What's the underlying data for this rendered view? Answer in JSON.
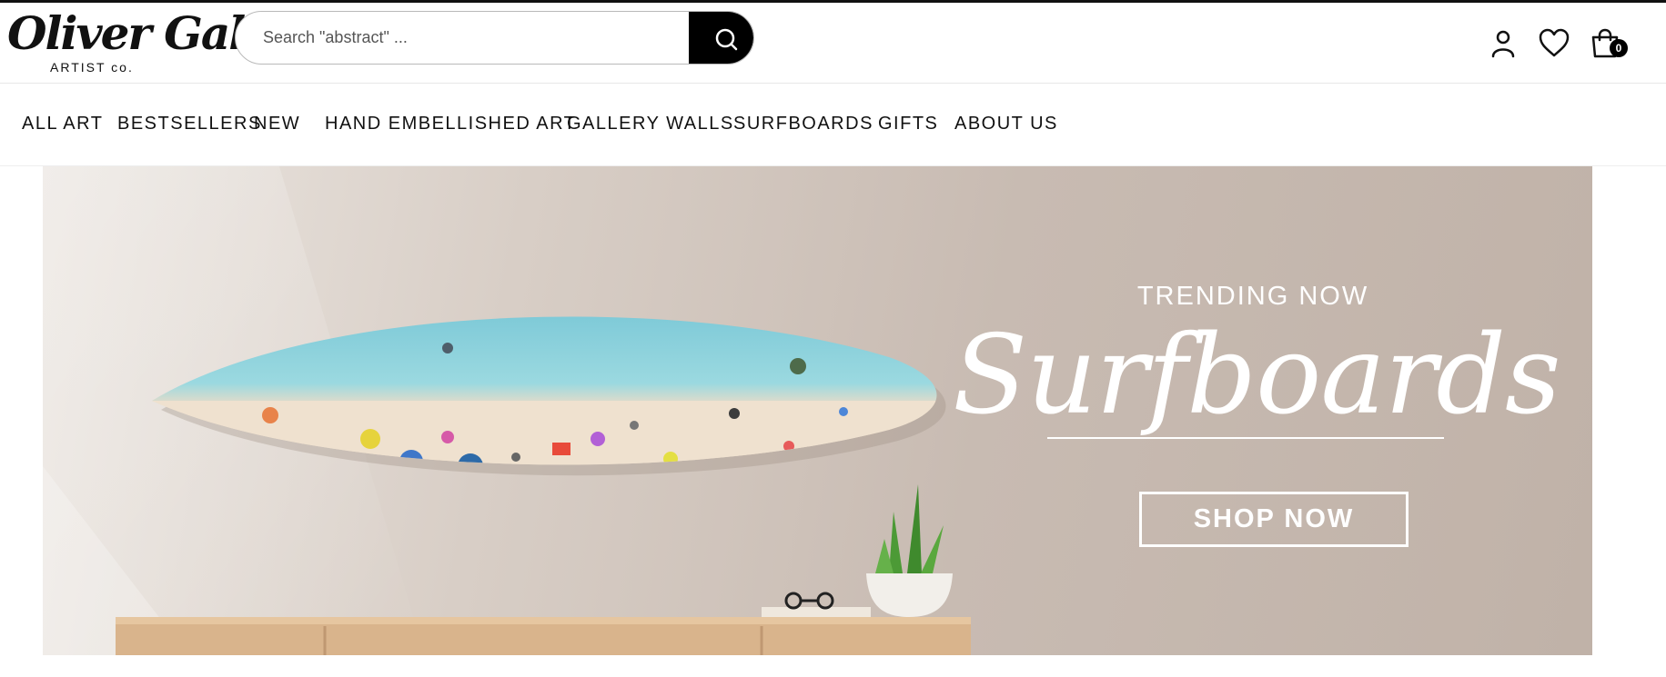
{
  "header": {
    "logo_script": "Oliver Gal",
    "logo_sub": "ARTIST co.",
    "search_placeholder": "Search \"abstract\" ...",
    "cart_count": "0"
  },
  "nav": {
    "items": [
      "ALL ART",
      "BESTSELLERS",
      "NEW",
      "HAND EMBELLISHED ART",
      "GALLERY WALLS",
      "SURFBOARDS",
      "GIFTS",
      "ABOUT US"
    ]
  },
  "hero": {
    "eyebrow": "TRENDING NOW",
    "headline": "Surfboards",
    "cta": "SHOP NOW"
  },
  "icons": {
    "search": "search-icon",
    "account": "user-icon",
    "wishlist": "heart-icon",
    "cart": "shopping-bag-icon"
  },
  "colors": {
    "accent": "#000000",
    "hero_text": "#ffffff",
    "hero_background": "#c8bbb2"
  }
}
